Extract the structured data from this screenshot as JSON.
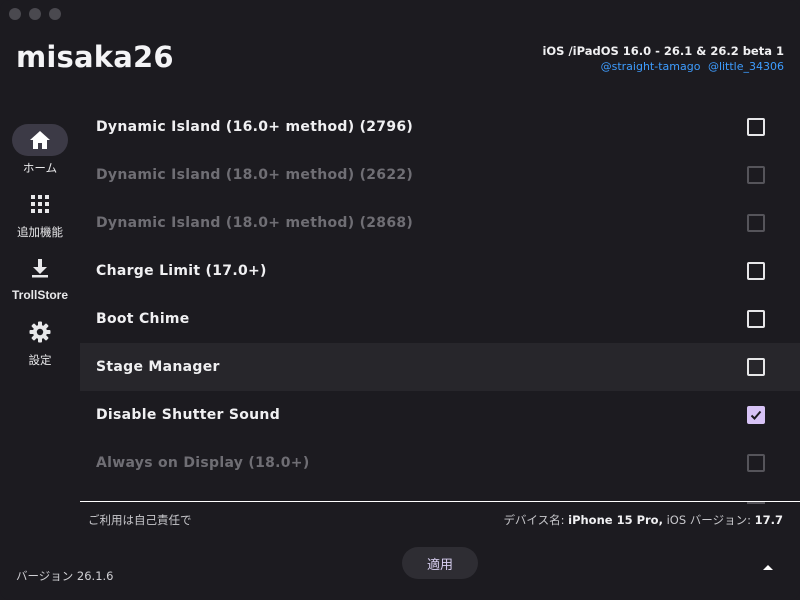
{
  "app": {
    "title": "misaka26",
    "os_range": "iOS /iPadOS 16.0 - 26.1 & 26.2 beta 1",
    "credits": [
      "@straight-tamago",
      "@little_34306"
    ]
  },
  "sidebar": {
    "items": [
      {
        "label": "ホーム",
        "icon": "home-icon",
        "active": true
      },
      {
        "label": "追加機能",
        "icon": "grid-icon",
        "active": false
      },
      {
        "label": "TrollStore",
        "icon": "download-icon",
        "active": false
      },
      {
        "label": "設定",
        "icon": "gear-icon",
        "active": false
      }
    ]
  },
  "tweaks": [
    {
      "label": "Dynamic Island (16.0+ method) (2796)",
      "enabled": true,
      "checked": false
    },
    {
      "label": "Dynamic Island (18.0+ method) (2622)",
      "enabled": false,
      "checked": false
    },
    {
      "label": "Dynamic Island (18.0+ method) (2868)",
      "enabled": false,
      "checked": false
    },
    {
      "label": "Charge Limit (17.0+)",
      "enabled": true,
      "checked": false
    },
    {
      "label": "Boot Chime",
      "enabled": true,
      "checked": false
    },
    {
      "label": "Stage Manager",
      "enabled": true,
      "checked": false
    },
    {
      "label": "Disable Shutter Sound",
      "enabled": true,
      "checked": true
    },
    {
      "label": "Always on Display (18.0+)",
      "enabled": false,
      "checked": false
    }
  ],
  "footer": {
    "note": "ご利用は自己責任で",
    "device_label": "デバイス名: ",
    "device_name": "iPhone 15 Pro,",
    "ios_label": "iOS バージョン: ",
    "ios_version": "17.7",
    "version": "バージョン 26.1.6",
    "apply_label": "適用"
  },
  "colors": {
    "background": "#1c1b20",
    "accent": "#d7c3f6",
    "link": "#3e9dff",
    "row_highlight": "#27262b"
  }
}
